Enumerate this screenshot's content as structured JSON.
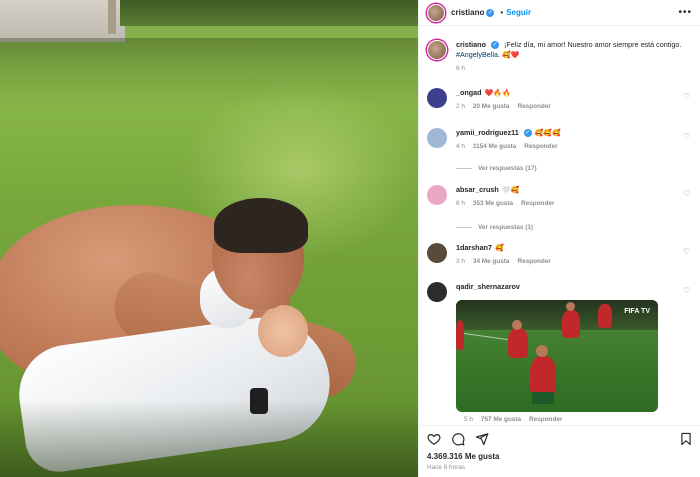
{
  "post": {
    "username": "cristiano",
    "follow_label": "Seguir",
    "dot": "•",
    "more": "•••",
    "verified_mark": "✓"
  },
  "caption": {
    "username": "cristiano",
    "text": "¡Feliz día, mi amor! Nuestro amor siempre está contigo.",
    "hashtag": "#AngelyBella.",
    "emoji": "🥰❤️",
    "time": "6 h"
  },
  "comments": [
    {
      "username": "_ongad",
      "text": "❤️🔥🔥",
      "time": "2 h",
      "likes": "20 Me gusta",
      "reply": "Responder",
      "avatar_color": "#3b3f8c"
    },
    {
      "username": "yamii_rodriguez11",
      "verified": true,
      "text": "🥰🥰🥰",
      "time": "4 h",
      "likes": "1154 Me gusta",
      "reply": "Responder",
      "avatar_color": "#9fb8d6",
      "view_replies": "Ver respuestas (17)"
    },
    {
      "username": "absar_crush",
      "text": "🤍🥰",
      "time": "6 h",
      "likes": "353 Me gusta",
      "reply": "Responder",
      "avatar_color": "#e9a7c4",
      "view_replies": "Ver respuestas (1)"
    },
    {
      "username": "1darshan7",
      "text": "🥰",
      "time": "3 h",
      "likes": "34 Me gusta",
      "reply": "Responder",
      "avatar_color": "#5a4a3a"
    },
    {
      "username": "qadir_shernazarov",
      "text": "",
      "time": "5 h",
      "likes": "757 Me gusta",
      "reply": "Responder",
      "avatar_color": "#2c2c2c",
      "gif_logo": "FIFA TV"
    }
  ],
  "footer": {
    "likes": "4.369.316 Me gusta",
    "ago": "Hace 6 horas"
  },
  "icons": [
    "more-icon",
    "heart-icon",
    "comment-icon",
    "share-icon",
    "bookmark-icon",
    "verified-icon"
  ],
  "colors": {
    "link": "#0095f6",
    "verified": "#3897f0",
    "hashtag": "#00376b",
    "muted": "#8e8e8e",
    "like_red": "#ed4956"
  }
}
